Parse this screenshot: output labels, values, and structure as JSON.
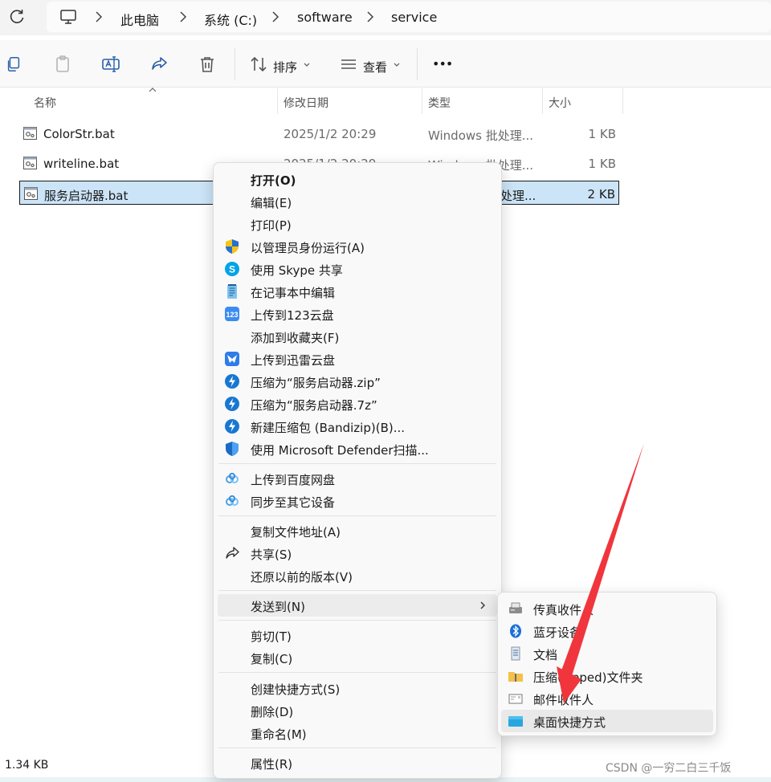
{
  "address": {
    "crumbs": [
      "此电脑",
      "系统 (C:)",
      "software",
      "service"
    ]
  },
  "toolbar": {
    "sort_label": "排序",
    "view_label": "查看",
    "more_label": "•••"
  },
  "columns": {
    "name": "名称",
    "date": "修改日期",
    "type": "类型",
    "size": "大小"
  },
  "files": [
    {
      "name": "ColorStr.bat",
      "date": "2025/1/2 20:29",
      "type": "Windows 批处理...",
      "size": "1 KB"
    },
    {
      "name": "writeline.bat",
      "date": "2025/1/2 20:29",
      "type": "Windows 批处理...",
      "size": "1 KB"
    },
    {
      "name": "服务启动器.bat",
      "date": "",
      "type": "处理...",
      "size": "2 KB"
    }
  ],
  "status": {
    "selected_size": "1.34 KB"
  },
  "watermark": "CSDN @一穷二白三千饭",
  "context_menu": {
    "items": [
      {
        "label": "打开(O)",
        "icon": "none"
      },
      {
        "label": "编辑(E)",
        "icon": "none"
      },
      {
        "label": "打印(P)",
        "icon": "none"
      },
      {
        "label": "以管理员身份运行(A)",
        "icon": "uac-shield-icon"
      },
      {
        "label": "使用 Skype 共享",
        "icon": "skype-icon"
      },
      {
        "label": "在记事本中编辑",
        "icon": "notepad-icon"
      },
      {
        "label": "上传到123云盘",
        "icon": "cloud-123-icon"
      },
      {
        "label": "添加到收藏夹(F)",
        "icon": "none"
      },
      {
        "label": "上传到迅雷云盘",
        "icon": "thunder-icon"
      },
      {
        "label": "压缩为“服务启动器.zip”",
        "icon": "bandizip-icon"
      },
      {
        "label": "压缩为“服务启动器.7z”",
        "icon": "bandizip-icon"
      },
      {
        "label": "新建压缩包 (Bandizip)(B)...",
        "icon": "bandizip-icon"
      },
      {
        "label": "使用 Microsoft Defender扫描...",
        "icon": "defender-icon"
      },
      {
        "label": "上传到百度网盘",
        "icon": "baidu-netdisk-icon"
      },
      {
        "label": "同步至其它设备",
        "icon": "baidu-netdisk-icon"
      },
      {
        "label": "复制文件地址(A)",
        "icon": "none"
      },
      {
        "label": "共享(S)",
        "icon": "share-icon"
      },
      {
        "label": "还原以前的版本(V)",
        "icon": "none"
      },
      {
        "label": "发送到(N)",
        "icon": "none"
      },
      {
        "label": "剪切(T)",
        "icon": "none"
      },
      {
        "label": "复制(C)",
        "icon": "none"
      },
      {
        "label": "创建快捷方式(S)",
        "icon": "none"
      },
      {
        "label": "删除(D)",
        "icon": "none"
      },
      {
        "label": "重命名(M)",
        "icon": "none"
      },
      {
        "label": "属性(R)",
        "icon": "none"
      }
    ]
  },
  "send_to_menu": {
    "items": [
      {
        "label": "传真收件人",
        "icon": "fax-icon"
      },
      {
        "label": "蓝牙设备",
        "icon": "bluetooth-icon"
      },
      {
        "label": "文档",
        "icon": "documents-icon"
      },
      {
        "label": "压缩(zipped)文件夹",
        "icon": "zip-folder-icon"
      },
      {
        "label": "邮件收件人",
        "icon": "mail-icon"
      },
      {
        "label": "桌面快捷方式",
        "icon": "desktop-icon"
      }
    ]
  },
  "colors": {
    "accent": "#0067c0",
    "selection": "#cce4f7",
    "annotation": "#f0353d"
  }
}
